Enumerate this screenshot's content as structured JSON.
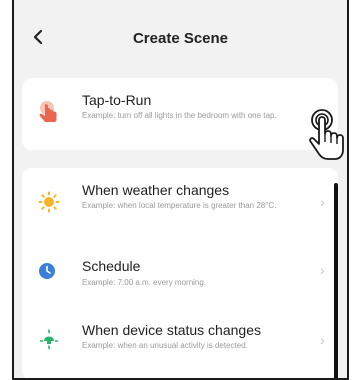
{
  "header": {
    "back_label": "<",
    "title": "Create Scene"
  },
  "tap_to_run": {
    "name": "Tap-to-Run",
    "description": "Example: turn off all lights in the bedroom with one tap.",
    "icon": "hand-tap-icon",
    "icon_color": "#e8674d"
  },
  "automation": [
    {
      "name": "When weather changes",
      "description": "Example: when local temperature is greater than 28°C.",
      "icon": "sun-icon",
      "icon_color": "#f5b52a"
    },
    {
      "name": "Schedule",
      "description": "Example: 7:00 a.m. every morning.",
      "icon": "clock-icon",
      "icon_color": "#3b7fd9"
    },
    {
      "name": "When device status changes",
      "description": "Example: when an unusual activity is detected.",
      "icon": "device-status-icon",
      "icon_color": "#27b36b"
    }
  ],
  "chevron": "›"
}
